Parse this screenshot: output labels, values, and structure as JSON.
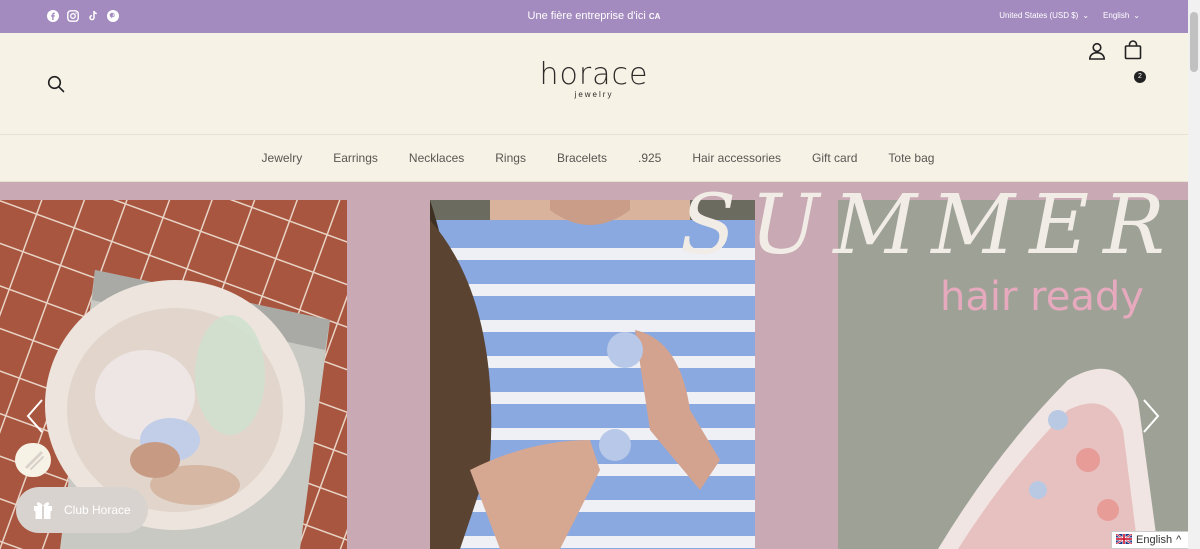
{
  "announcement": {
    "text": "Une fière entreprise d'ici",
    "country_tag": "CA",
    "currency": "United States (USD $)",
    "language": "English"
  },
  "social_icons": [
    "facebook-icon",
    "instagram-icon",
    "tiktok-icon",
    "pinterest-icon"
  ],
  "header": {
    "logo_main": "horace",
    "logo_sub": "jewelry",
    "cart_count": "2"
  },
  "nav": {
    "items": [
      "Jewelry",
      "Earrings",
      "Necklaces",
      "Rings",
      "Bracelets",
      ".925",
      "Hair accessories",
      "Gift card",
      "Tote bag"
    ]
  },
  "hero": {
    "title": "SUMMER",
    "subtitle": "hair ready"
  },
  "club_button": {
    "label": "Club Horace"
  },
  "language_widget": {
    "label": "English"
  },
  "colors": {
    "announcement_bg": "#a48bbf",
    "header_bg": "#f7f2e6",
    "hero_bg": "#c9a9b4"
  }
}
